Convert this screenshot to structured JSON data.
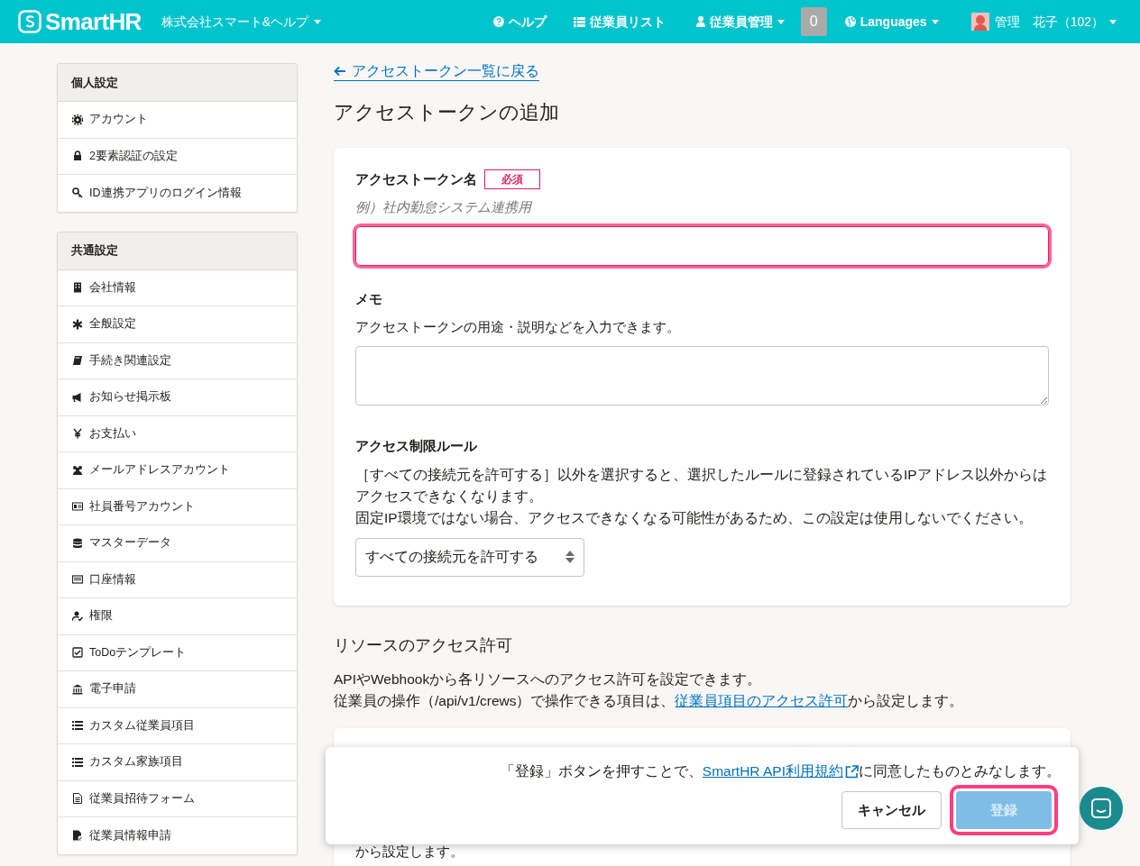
{
  "header": {
    "logo": "SmartHR",
    "company": "株式会社スマート&ヘルプ",
    "nav": [
      {
        "label": "ヘルプ",
        "caret": false
      },
      {
        "label": "従業員リスト",
        "caret": false
      },
      {
        "label": "従業員管理",
        "caret": true
      }
    ],
    "count_badge": "0",
    "languages": "Languages",
    "user": "管理　花子（102）"
  },
  "sidebar": {
    "sections": [
      {
        "title": "個人設定",
        "items": [
          {
            "label": "アカウント"
          },
          {
            "label": "2要素認証の設定"
          },
          {
            "label": "ID連携アプリのログイン情報"
          }
        ]
      },
      {
        "title": "共通設定",
        "items": [
          {
            "label": "会社情報"
          },
          {
            "label": "全般設定"
          },
          {
            "label": "手続き関連設定"
          },
          {
            "label": "お知らせ掲示板"
          },
          {
            "label": "お支払い"
          },
          {
            "label": "メールアドレスアカウント"
          },
          {
            "label": "社員番号アカウント"
          },
          {
            "label": "マスターデータ"
          },
          {
            "label": "口座情報"
          },
          {
            "label": "権限"
          },
          {
            "label": "ToDoテンプレート"
          },
          {
            "label": "電子申請"
          },
          {
            "label": "カスタム従業員項目"
          },
          {
            "label": "カスタム家族項目"
          },
          {
            "label": "従業員招待フォーム"
          },
          {
            "label": "従業員情報申請"
          }
        ]
      }
    ]
  },
  "main": {
    "back_link": "アクセストークン一覧に戻る",
    "title": "アクセストークンの追加",
    "form": {
      "name_field": {
        "label": "アクセストークン名",
        "required": "必須",
        "hint": "例）社内勤怠システム連携用",
        "highlighted": true
      },
      "memo_field": {
        "label": "メモ",
        "description": "アクセストークンの用途・説明などを入力できます。"
      },
      "rule_field": {
        "label": "アクセス制限ルール",
        "description": [
          "［すべての接続元を許可する］以外を選択すると、選択したルールに登録されているIPアドレス以外からはアクセスできなくなります。",
          "固定IP環境ではない場合、アクセスできなくなる可能性があるため、この設定は使用しないでください。"
        ],
        "value": "すべての接続元を許可する"
      }
    },
    "resources": {
      "title": "リソースのアクセス許可",
      "intro": "APIやWebhookから各リソースへのアクセス許可を設定できます。",
      "note_prefix": "従業員の操作（/api/v1/crews）で操作できる項目は、",
      "note_link": "従業員項目のアクセス許可",
      "note_suffix": "から設定します。",
      "card": {
        "text": "から設定します。"
      }
    }
  },
  "footer": {
    "notice_prefix": "「登録」ボタンを押すことで、",
    "notice_link": "SmartHR API利用規約",
    "notice_suffix": "に同意したものとみなします。",
    "cancel": "キャンセル",
    "submit": {
      "label": "登録",
      "disabled": true,
      "highlighted": true
    }
  }
}
